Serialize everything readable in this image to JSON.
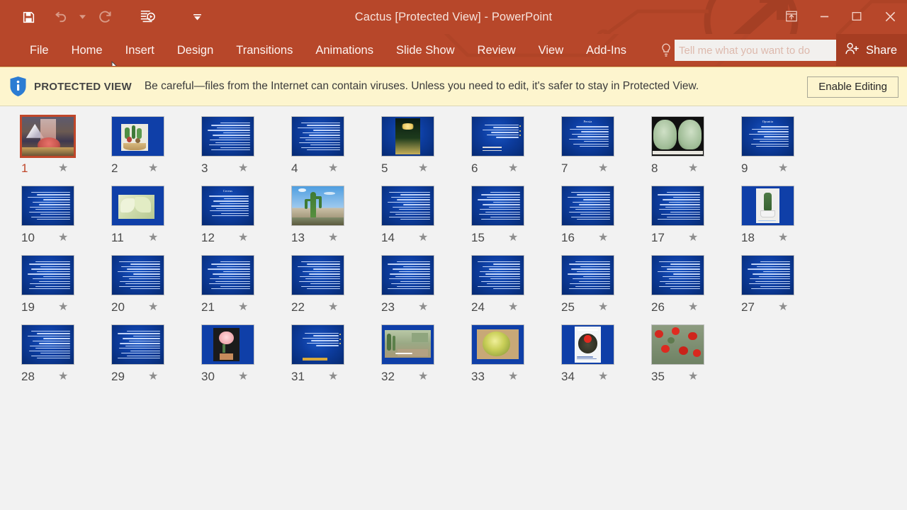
{
  "window": {
    "title": "Cactus [Protected View] - PowerPoint",
    "quick_access": [
      {
        "name": "save-icon",
        "label": "Save",
        "state": "enabled"
      },
      {
        "name": "undo-icon",
        "label": "Undo",
        "state": "disabled"
      },
      {
        "name": "undo-dropdown-icon",
        "label": "Undo options",
        "state": "disabled"
      },
      {
        "name": "redo-icon",
        "label": "Redo",
        "state": "disabled"
      },
      {
        "name": "start-slideshow-icon",
        "label": "Start From Beginning",
        "state": "enabled"
      },
      {
        "name": "customize-qat-icon",
        "label": "Customize Quick Access Toolbar",
        "state": "enabled"
      }
    ],
    "controls": [
      {
        "name": "ribbon-display-options-icon",
        "label": "Ribbon Display Options"
      },
      {
        "name": "minimize-icon",
        "label": "Minimize"
      },
      {
        "name": "restore-icon",
        "label": "Restore Down"
      },
      {
        "name": "close-icon",
        "label": "Close"
      }
    ]
  },
  "ribbon": {
    "tabs": [
      {
        "label": "File"
      },
      {
        "label": "Home"
      },
      {
        "label": "Insert"
      },
      {
        "label": "Design"
      },
      {
        "label": "Transitions"
      },
      {
        "label": "Animations"
      },
      {
        "label": "Slide Show"
      },
      {
        "label": "Review"
      },
      {
        "label": "View"
      },
      {
        "label": "Add-Ins"
      }
    ],
    "active_tab": "Home",
    "tellme": {
      "value": "",
      "placeholder": "Tell me what you want to do",
      "icon": "lightbulb-icon"
    },
    "share": {
      "label": "Share",
      "icon": "person-add-icon"
    }
  },
  "protected_view": {
    "icon": "shield-info-icon",
    "label": "PROTECTED VIEW",
    "message": "Be careful—files from the Internet can contain viruses. Unless you need to edit, it's safer to stay in Protected View.",
    "button": "Enable Editing"
  },
  "colors": {
    "ribbon": "#b7472a",
    "selection": "#c0472a",
    "banner": "#fdf5ce",
    "banner_border": "#e8b96a",
    "workspace": "#f2f2f2",
    "slide_blue": "#0f3fa8"
  },
  "slide_sorter": {
    "selected": 1,
    "total": 35,
    "star_icon": "star-icon",
    "slides": [
      {
        "n": "1",
        "kind": "photo-full",
        "desc": "Mountain landscape with cactus title art",
        "star": "★"
      },
      {
        "n": "2",
        "kind": "photo-inset",
        "desc": "Bowl of assorted small cacti",
        "star": "★"
      },
      {
        "n": "3",
        "kind": "text",
        "desc": "Arabic body text",
        "star": "★"
      },
      {
        "n": "4",
        "kind": "text",
        "desc": "Arabic body text",
        "star": "★"
      },
      {
        "n": "5",
        "kind": "photo-portrait",
        "desc": "Yellow cactus flower at night",
        "star": "★"
      },
      {
        "n": "6",
        "kind": "text-list",
        "desc": "Bulleted Arabic list",
        "star": "★"
      },
      {
        "n": "7",
        "kind": "text-title",
        "title": "Persia",
        "desc": "Titled Arabic body text",
        "star": "★"
      },
      {
        "n": "8",
        "kind": "photo-full",
        "desc": "Two prickly pear pads",
        "star": "★"
      },
      {
        "n": "9",
        "kind": "text-title",
        "title": "Opuntia",
        "desc": "Titled Arabic body text",
        "star": "★"
      },
      {
        "n": "10",
        "kind": "text",
        "desc": "Arabic body text",
        "star": "★"
      },
      {
        "n": "11",
        "kind": "photo-inset",
        "desc": "Pale green succulent close-up",
        "star": "★"
      },
      {
        "n": "12",
        "kind": "text-title",
        "title": "Cereus",
        "desc": "Titled Arabic body text",
        "star": "★"
      },
      {
        "n": "13",
        "kind": "photo-full",
        "desc": "Saguaro cactus in desert under blue sky",
        "star": "★"
      },
      {
        "n": "14",
        "kind": "text",
        "desc": "Arabic body text",
        "star": "★"
      },
      {
        "n": "15",
        "kind": "text",
        "desc": "Arabic body text",
        "star": "★"
      },
      {
        "n": "16",
        "kind": "text",
        "desc": "Arabic body text",
        "star": "★"
      },
      {
        "n": "17",
        "kind": "text",
        "desc": "Arabic body text",
        "star": "★"
      },
      {
        "n": "18",
        "kind": "photo-portrait",
        "desc": "Potted columnar cactus on white",
        "star": "★"
      },
      {
        "n": "19",
        "kind": "text",
        "desc": "Arabic body text",
        "star": "★"
      },
      {
        "n": "20",
        "kind": "text",
        "desc": "Arabic body text",
        "star": "★"
      },
      {
        "n": "21",
        "kind": "text",
        "desc": "Arabic body text",
        "star": "★"
      },
      {
        "n": "22",
        "kind": "text",
        "desc": "Arabic body text",
        "star": "★"
      },
      {
        "n": "23",
        "kind": "text",
        "desc": "Arabic body text",
        "star": "★"
      },
      {
        "n": "24",
        "kind": "text",
        "desc": "Arabic body text",
        "star": "★"
      },
      {
        "n": "25",
        "kind": "text",
        "desc": "Arabic body text",
        "star": "★"
      },
      {
        "n": "26",
        "kind": "text",
        "desc": "Arabic body text",
        "star": "★"
      },
      {
        "n": "27",
        "kind": "text",
        "desc": "Arabic body text",
        "star": "★"
      },
      {
        "n": "28",
        "kind": "text",
        "desc": "Arabic body text",
        "star": "★"
      },
      {
        "n": "29",
        "kind": "text",
        "desc": "Arabic body text",
        "star": "★"
      },
      {
        "n": "30",
        "kind": "photo-inset",
        "desc": "Pink cactus flower in pot",
        "star": "★"
      },
      {
        "n": "31",
        "kind": "text-list",
        "desc": "Numbered Arabic list with highlight",
        "star": "★"
      },
      {
        "n": "32",
        "kind": "photo-inset",
        "desc": "Desert garden path with cacti",
        "star": "★"
      },
      {
        "n": "33",
        "kind": "photo-inset",
        "desc": "Golden barrel cactus on gravel",
        "star": "★"
      },
      {
        "n": "34",
        "kind": "photo-inset",
        "desc": "Barrel cactus with red flower on white card",
        "star": "★"
      },
      {
        "n": "35",
        "kind": "photo-full",
        "desc": "Red cactus fruits on green plant",
        "star": "★"
      }
    ]
  }
}
